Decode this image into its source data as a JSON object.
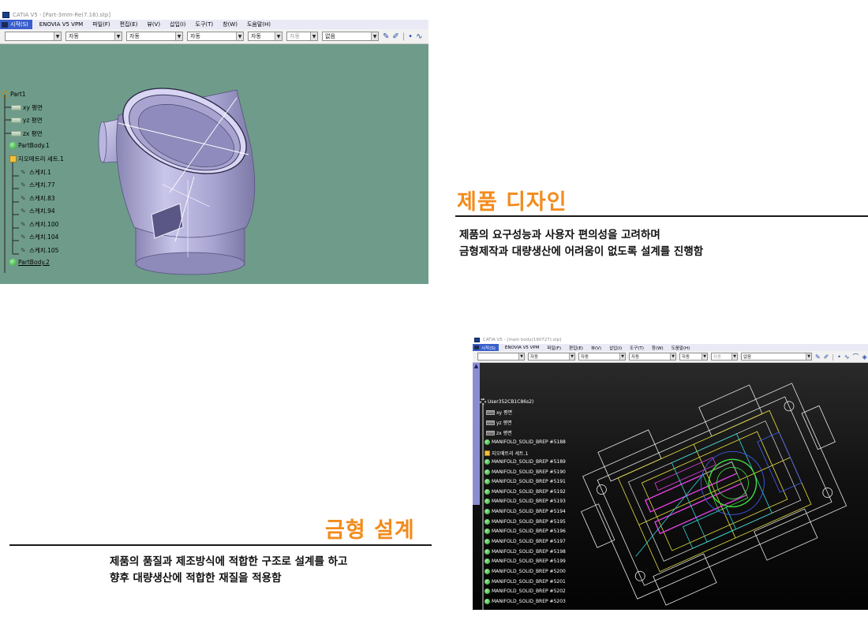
{
  "window1": {
    "title": "CATIA V5 - [Part-3mm-Re(7.16).stp]",
    "start_menu": "시작(S)",
    "menu": [
      "ENOVIA V5 VPM",
      "파일(F)",
      "편집(E)",
      "뷰(V)",
      "삽입(I)",
      "도구(T)",
      "창(W)",
      "도움말(H)"
    ],
    "toolbar": {
      "combo_blank": "",
      "combos": [
        "자동",
        "자동",
        "자동",
        "자동",
        "자동"
      ],
      "combo_disabled": "자동",
      "combo_last": "없음"
    },
    "tree": {
      "root": "Part1",
      "planes": [
        "xy 평면",
        "yz 평면",
        "zx 평면"
      ],
      "body1": "PartBody.1",
      "geoset": "지오메트리 세트.1",
      "sketches": [
        "스케치.1",
        "스케치.77",
        "스케치.83",
        "스케치.94",
        "스케치.100",
        "스케치.104",
        "스케치.105"
      ],
      "body2": "PartBody.2"
    },
    "viewport_color": "#6f9c8a"
  },
  "window2": {
    "title": "CATIA V5 - [main body(190727).stp]",
    "start_menu": "시작(S)",
    "menu": [
      "ENOVIA V5 VPM",
      "파일(F)",
      "편집(E)",
      "뷰(V)",
      "삽입(I)",
      "도구(T)",
      "창(W)",
      "도움말(H)"
    ],
    "toolbar": {
      "combo_blank": "",
      "combos": [
        "자동",
        "자동",
        "자동",
        "자동",
        "자동"
      ],
      "combo_disabled": "자동",
      "combo_last": "없음"
    },
    "tree": {
      "root": "User352CB1C86s2)",
      "planes": [
        "xy 평면",
        "yz 평면",
        "zx 평면"
      ],
      "first_body": "MANIFOLD_SOLID_BREP #5188",
      "geoset": "지오메트리 세트.1",
      "bodies": [
        "MANIFOLD_SOLID_BREP #5189",
        "MANIFOLD_SOLID_BREP #5190",
        "MANIFOLD_SOLID_BREP #5191",
        "MANIFOLD_SOLID_BREP #5192",
        "MANIFOLD_SOLID_BREP #5193",
        "MANIFOLD_SOLID_BREP #5194",
        "MANIFOLD_SOLID_BREP #5195",
        "MANIFOLD_SOLID_BREP #5196",
        "MANIFOLD_SOLID_BREP #5197",
        "MANIFOLD_SOLID_BREP #5198",
        "MANIFOLD_SOLID_BREP #5199",
        "MANIFOLD_SOLID_BREP #5200",
        "MANIFOLD_SOLID_BREP #5201",
        "MANIFOLD_SOLID_BREP #5202",
        "MANIFOLD_SOLID_BREP #5203"
      ]
    }
  },
  "section_design": {
    "title": "제품 디자인",
    "lines": [
      "제품의 요구성능과 사용자 편의성을 고려하며",
      "금형제작과 대량생산에 어려움이 없도록 설계를 진행함"
    ]
  },
  "section_mold": {
    "title": "금형 설계",
    "lines": [
      "제품의 품질과 제조방식에 적합한 구조로 설계를 하고",
      "향후 대량생산에 적합한 재질을 적용함"
    ]
  },
  "colors": {
    "accent_orange": "#f28b1c",
    "catia_blue": "#3a5fcd"
  }
}
